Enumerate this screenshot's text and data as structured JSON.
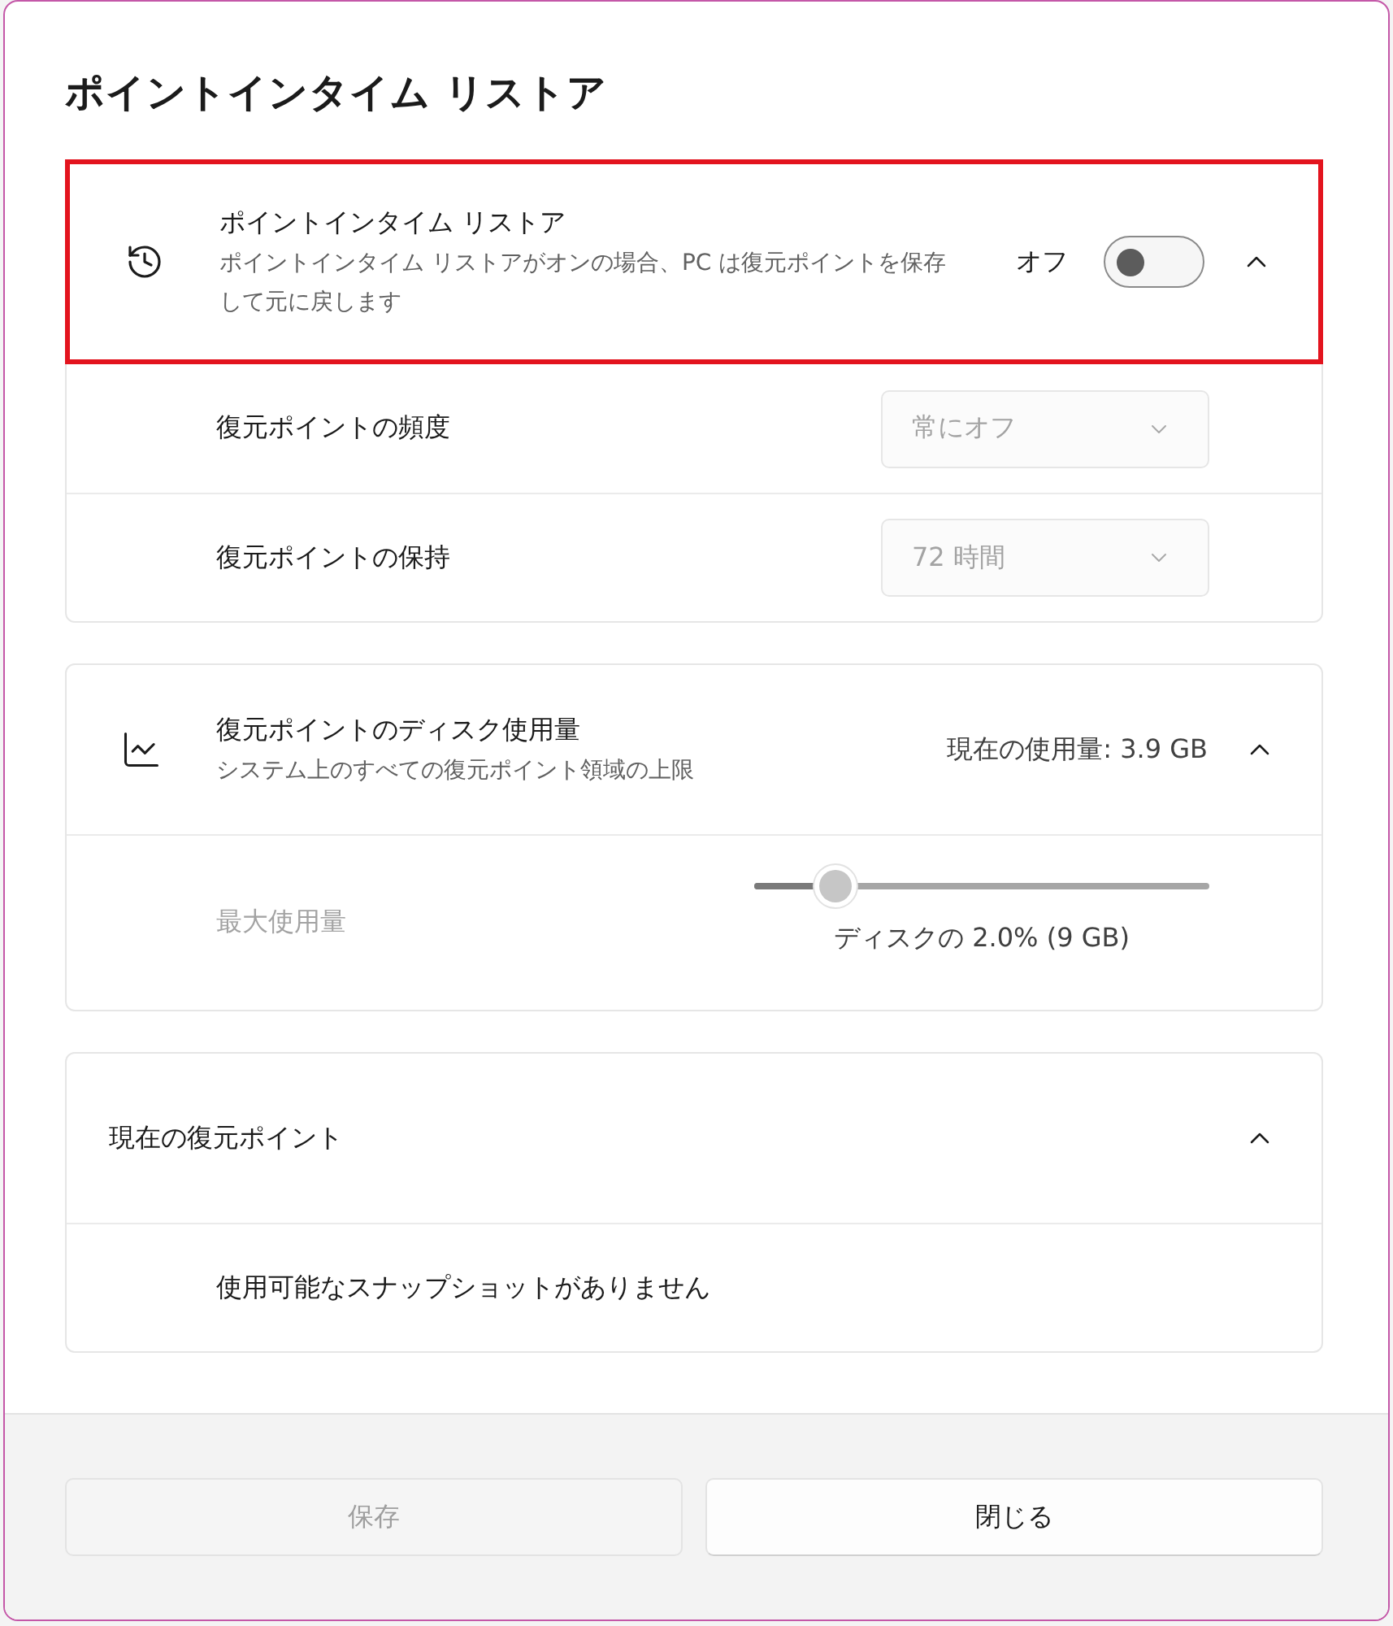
{
  "dialog": {
    "title": "ポイントインタイム リストア"
  },
  "sections": [
    {
      "kind": "toggle",
      "highlighted": true,
      "expanded": true,
      "title": "ポイントインタイム リストア",
      "description": "ポイントインタイム リストアがオンの場合、PC は復元ポイントを保存して元に戻します",
      "toggle": {
        "label": "オフ",
        "on": false
      },
      "rows": [
        {
          "kind": "dropdown",
          "label": "復元ポイントの頻度",
          "value": "常にオフ",
          "disabled": true
        },
        {
          "kind": "dropdown",
          "label": "復元ポイントの保持",
          "value": "72 時間",
          "disabled": true
        }
      ]
    },
    {
      "kind": "usage",
      "highlighted": false,
      "expanded": true,
      "title": "復元ポイントのディスク使用量",
      "description": "システム上のすべての復元ポイント領域の上限",
      "reading": "現在の使用量: 3.9 GB",
      "rows": [
        {
          "kind": "slider",
          "label": "最大使用量",
          "disabled": true,
          "level": 0.18,
          "caption": "ディスクの 2.0% (9 GB)"
        }
      ]
    },
    {
      "kind": "plain",
      "highlighted": false,
      "expanded": true,
      "title": "現在の復元ポイント",
      "rows": [
        {
          "kind": "message",
          "text": "使用可能なスナップショットがありません"
        }
      ]
    }
  ],
  "footer": {
    "buttons": [
      {
        "label": "保存",
        "disabled": true
      },
      {
        "label": "閉じる",
        "disabled": false
      }
    ]
  }
}
